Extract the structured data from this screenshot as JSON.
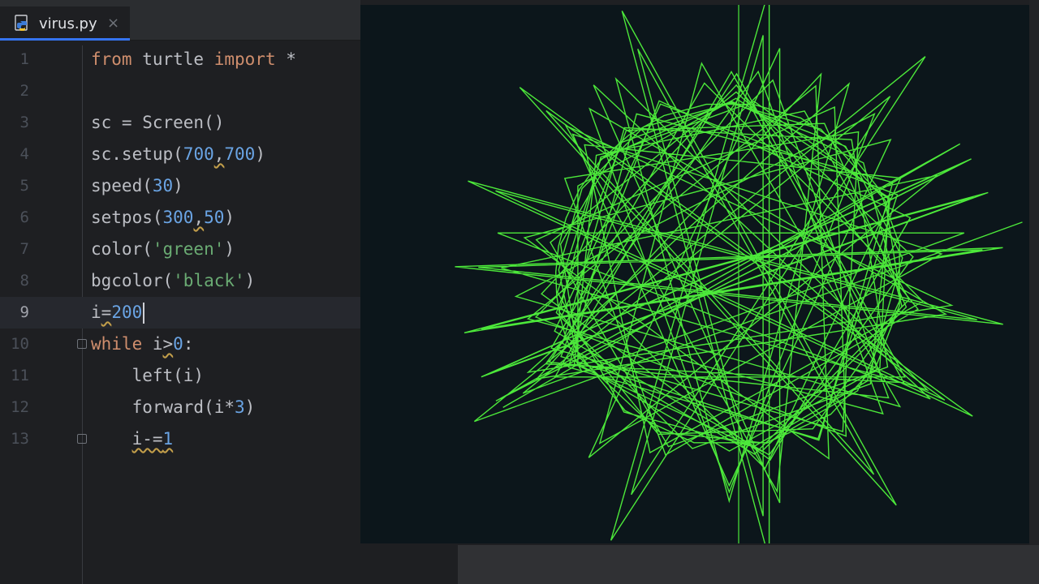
{
  "tab": {
    "filename": "virus.py",
    "close_glyph": "×",
    "icon": "python-file-icon"
  },
  "editor": {
    "lines": [
      {
        "n": "1"
      },
      {
        "n": "2"
      },
      {
        "n": "3"
      },
      {
        "n": "4"
      },
      {
        "n": "5"
      },
      {
        "n": "6"
      },
      {
        "n": "7"
      },
      {
        "n": "8"
      },
      {
        "n": "9"
      },
      {
        "n": "10"
      },
      {
        "n": "11"
      },
      {
        "n": "12"
      },
      {
        "n": "13"
      }
    ],
    "tokens": {
      "l1_from": "from",
      "l1_mod": " turtle ",
      "l1_import": "import",
      "l1_star": " *",
      "l3": "sc = Screen()",
      "l4_a": "sc.setup(",
      "l4_n1": "700",
      "l4_c": ",",
      "l4_n2": "700",
      "l4_b": ")",
      "l5_a": "speed(",
      "l5_n": "30",
      "l5_b": ")",
      "l6_a": "setpos(",
      "l6_n1": "300",
      "l6_c": ",",
      "l6_n2": "50",
      "l6_b": ")",
      "l7_a": "color(",
      "l7_s": "'green'",
      "l7_b": ")",
      "l8_a": "bgcolor(",
      "l8_s": "'black'",
      "l8_b": ")",
      "l9_a": "i",
      "l9_eq": "=",
      "l9_n": "200",
      "l10_kw": "while",
      "l10_a": " i",
      "l10_gt": ">",
      "l10_n": "0",
      "l10_b": ":",
      "l11": "    left(i)",
      "l12_a": "    forward(i*",
      "l12_n": "3",
      "l12_b": ")",
      "l13_pad": "    ",
      "l13_a": "i-=",
      "l13_n": "1"
    },
    "current_line": 9
  },
  "turtle": {
    "background": "#0c161b",
    "pen_color": "#4ce83a",
    "start": [
      300,
      50
    ],
    "initial_i": 200,
    "step_multiplier": 3
  }
}
